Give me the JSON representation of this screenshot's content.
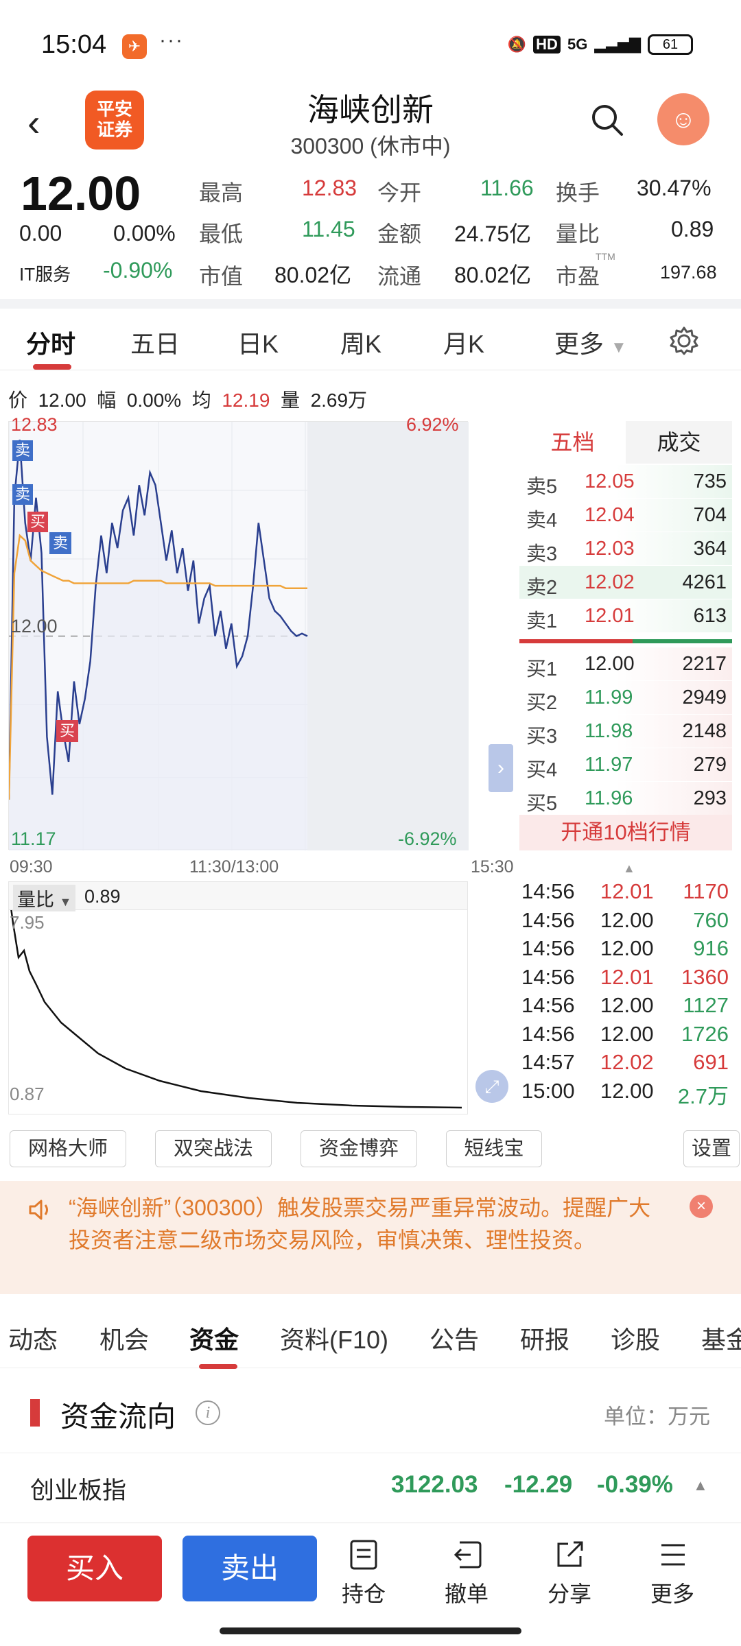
{
  "status_bar": {
    "time": "15:04",
    "more": "···",
    "network": "5G",
    "hd": "HD",
    "battery": "61"
  },
  "header": {
    "title": "海峡创新",
    "subtitle": "300300 (休市中)",
    "logo_text": "平安证券",
    "back_icon": "chevron-left-icon",
    "search_icon": "search-icon"
  },
  "quote": {
    "price": "12.00",
    "change": "0.00",
    "change_pct": "0.00%",
    "sector_name": "IT服务",
    "sector_pct": "-0.90%",
    "high_label": "最高",
    "high": "12.83",
    "open_label": "今开",
    "open": "11.66",
    "turnover_label": "换手",
    "turnover": "30.47%",
    "low_label": "最低",
    "low": "11.45",
    "amount_label": "金额",
    "amount": "24.75亿",
    "volratio_label": "量比",
    "volratio": "0.89",
    "mcap_label": "市值",
    "mcap": "80.02亿",
    "float_label": "流通",
    "float": "80.02亿",
    "pe_label": "市盈",
    "pe_sup": "TTM",
    "pe": "197.68"
  },
  "period_tabs": [
    "分时",
    "五日",
    "日K",
    "周K",
    "月K",
    "更多"
  ],
  "info_bar": {
    "price_label": "价",
    "price": "12.00",
    "range_label": "幅",
    "range": "0.00%",
    "avg_label": "均",
    "avg": "12.19",
    "vol_label": "量",
    "vol": "2.69万"
  },
  "chart_labels": {
    "ymax": "12.83",
    "ymin": "11.17",
    "mid": "12.00",
    "pct_max": "6.92%",
    "pct_min": "-6.92%",
    "t_start": "09:30",
    "t_mid": "11:30/13:00",
    "t_end": "15:30",
    "sell": "卖",
    "buy": "买"
  },
  "chart_data": {
    "type": "line",
    "ylim": [
      11.17,
      12.83
    ],
    "series": [
      {
        "name": "price",
        "values": [
          11.35,
          12.55,
          12.78,
          12.45,
          12.3,
          12.55,
          12.33,
          11.6,
          11.37,
          11.78,
          11.62,
          11.5,
          11.82,
          11.65,
          11.75,
          11.9,
          12.2,
          12.4,
          12.25,
          12.45,
          12.35,
          12.5,
          12.55,
          12.4,
          12.6,
          12.48,
          12.65,
          12.6,
          12.45,
          12.3,
          12.42,
          12.25,
          12.35,
          12.18,
          12.3,
          12.05,
          12.15,
          12.2,
          12.0,
          12.1,
          11.95,
          12.05,
          11.88,
          11.92,
          12.0,
          12.2,
          12.45,
          12.3,
          12.15,
          12.1,
          12.08,
          12.05,
          12.02,
          12.0,
          12.01,
          12.0
        ]
      },
      {
        "name": "avg",
        "values": [
          11.35,
          12.25,
          12.4,
          12.38,
          12.3,
          12.28,
          12.26,
          12.25,
          12.24,
          12.23,
          12.22,
          12.22,
          12.21,
          12.21,
          12.21,
          12.21,
          12.21,
          12.21,
          12.21,
          12.21,
          12.21,
          12.21,
          12.21,
          12.22,
          12.22,
          12.22,
          12.22,
          12.22,
          12.22,
          12.21,
          12.21,
          12.21,
          12.21,
          12.21,
          12.21,
          12.21,
          12.21,
          12.21,
          12.2,
          12.2,
          12.2,
          12.2,
          12.2,
          12.2,
          12.2,
          12.2,
          12.2,
          12.2,
          12.2,
          12.2,
          12.2,
          12.19,
          12.19,
          12.19,
          12.19,
          12.19
        ]
      }
    ]
  },
  "orderbook": {
    "tabs": [
      "五档",
      "成交"
    ],
    "asks": [
      {
        "label": "卖5",
        "price": "12.05",
        "vol": "735"
      },
      {
        "label": "卖4",
        "price": "12.04",
        "vol": "704"
      },
      {
        "label": "卖3",
        "price": "12.03",
        "vol": "364"
      },
      {
        "label": "卖2",
        "price": "12.02",
        "vol": "4261"
      },
      {
        "label": "卖1",
        "price": "12.01",
        "vol": "613"
      }
    ],
    "bids": [
      {
        "label": "买1",
        "price": "12.00",
        "vol": "2217"
      },
      {
        "label": "买2",
        "price": "11.99",
        "vol": "2949"
      },
      {
        "label": "买3",
        "price": "11.98",
        "vol": "2148"
      },
      {
        "label": "买4",
        "price": "11.97",
        "vol": "279"
      },
      {
        "label": "买5",
        "price": "11.96",
        "vol": "293"
      }
    ],
    "open10": "开通10档行情"
  },
  "volume_chart": {
    "selector": "量比",
    "value": "0.89",
    "top": "7.95",
    "bottom": "0.87"
  },
  "trades": [
    {
      "time": "14:56",
      "price": "12.01",
      "vol": "1170",
      "dir": "up"
    },
    {
      "time": "14:56",
      "price": "12.00",
      "vol": "760",
      "dir": "down"
    },
    {
      "time": "14:56",
      "price": "12.00",
      "vol": "916",
      "dir": "down"
    },
    {
      "time": "14:56",
      "price": "12.01",
      "vol": "1360",
      "dir": "up"
    },
    {
      "time": "14:56",
      "price": "12.00",
      "vol": "1127",
      "dir": "down"
    },
    {
      "time": "14:56",
      "price": "12.00",
      "vol": "1726",
      "dir": "down"
    },
    {
      "time": "14:57",
      "price": "12.02",
      "vol": "691",
      "dir": "up"
    },
    {
      "time": "15:00",
      "price": "12.00",
      "vol": "2.7万",
      "dir": "down"
    }
  ],
  "tools": [
    "网格大师",
    "双突战法",
    "资金博弈",
    "短线宝",
    "设置"
  ],
  "alert": {
    "text": "“海峡创新”（300300）触发股票交易严重异常波动。提醒广大投资者注意二级市场交易风险，审慎决策、理性投资。"
  },
  "content_tabs": [
    "动态",
    "机会",
    "资金",
    "资料(F10)",
    "公告",
    "研报",
    "诊股",
    "基金"
  ],
  "fund_flow": {
    "title": "资金流向",
    "unit": "单位：万元",
    "info": "i"
  },
  "index_row": {
    "name": "创业板指",
    "value": "3122.03",
    "change": "-12.29",
    "pct": "-0.39%"
  },
  "bottom_bar": {
    "buy": "买入",
    "sell": "卖出",
    "items": [
      "持仓",
      "撤单",
      "分享",
      "更多"
    ]
  },
  "colors": {
    "up": "#d63b3b",
    "down": "#2f9a5a",
    "accent_blue": "#2f6fe0",
    "price_line": "#2a3f8f",
    "avg_line": "#f0a43a"
  }
}
